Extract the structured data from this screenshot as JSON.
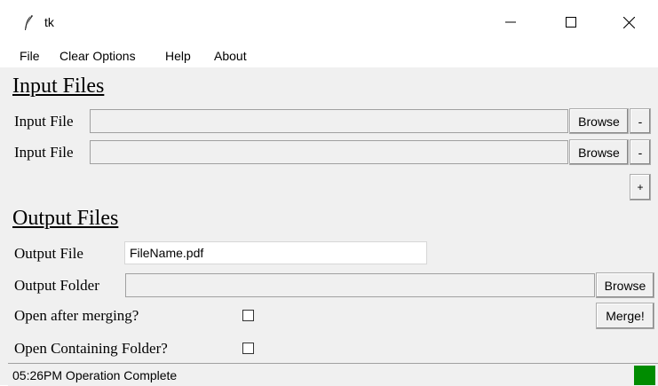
{
  "window": {
    "title": "tk",
    "minimize_glyph": "—",
    "maximize_glyph": "☐",
    "close_glyph": "✕"
  },
  "menu": [
    "File",
    "Clear Options",
    "Help",
    "About"
  ],
  "input_section": {
    "heading": "Input Files",
    "rows": [
      {
        "label": "Input File",
        "value": "",
        "browse": "Browse",
        "remove": "-"
      },
      {
        "label": "Input File",
        "value": "",
        "browse": "Browse",
        "remove": "-"
      }
    ],
    "add": "+"
  },
  "output_section": {
    "heading": "Output Files",
    "output_file_label": "Output File",
    "output_file_value": "FileName.pdf",
    "output_folder_label": "Output Folder",
    "output_folder_value": "",
    "browse": "Browse",
    "open_after_label": "Open after merging?",
    "open_after_checked": false,
    "open_folder_label": "Open Containing Folder?",
    "open_folder_checked": false,
    "merge": "Merge!"
  },
  "status": {
    "text": "05:26PM Operation Complete",
    "indicator_color": "#008c00"
  }
}
